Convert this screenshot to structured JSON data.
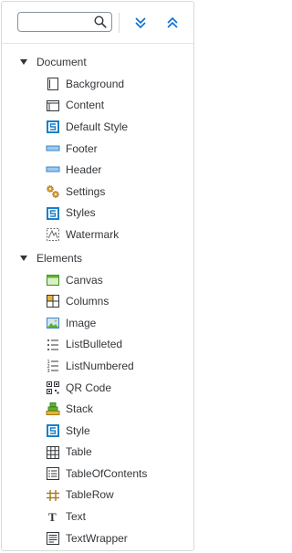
{
  "search": {
    "value": "",
    "placeholder": ""
  },
  "toolbar": {
    "expand_all_icon": "double-chevron-down-icon",
    "collapse_all_icon": "double-chevron-up-icon",
    "accent_color": "#0a6ed1"
  },
  "groups": [
    {
      "label": "Document",
      "items": [
        {
          "label": "Background",
          "icon": "background-icon"
        },
        {
          "label": "Content",
          "icon": "content-icon"
        },
        {
          "label": "Default Style",
          "icon": "style-icon"
        },
        {
          "label": "Footer",
          "icon": "footer-icon"
        },
        {
          "label": "Header",
          "icon": "header-icon"
        },
        {
          "label": "Settings",
          "icon": "settings-icon"
        },
        {
          "label": "Styles",
          "icon": "style-icon"
        },
        {
          "label": "Watermark",
          "icon": "watermark-icon"
        }
      ]
    },
    {
      "label": "Elements",
      "items": [
        {
          "label": "Canvas",
          "icon": "canvas-icon"
        },
        {
          "label": "Columns",
          "icon": "columns-icon"
        },
        {
          "label": "Image",
          "icon": "image-icon"
        },
        {
          "label": "ListBulleted",
          "icon": "list-bulleted-icon"
        },
        {
          "label": "ListNumbered",
          "icon": "list-numbered-icon"
        },
        {
          "label": "QR Code",
          "icon": "qr-code-icon"
        },
        {
          "label": "Stack",
          "icon": "stack-icon"
        },
        {
          "label": "Style",
          "icon": "style-icon"
        },
        {
          "label": "Table",
          "icon": "table-icon"
        },
        {
          "label": "TableOfContents",
          "icon": "table-of-contents-icon"
        },
        {
          "label": "TableRow",
          "icon": "table-row-icon"
        },
        {
          "label": "Text",
          "icon": "text-icon"
        },
        {
          "label": "TextWrapper",
          "icon": "text-wrapper-icon"
        }
      ]
    }
  ]
}
